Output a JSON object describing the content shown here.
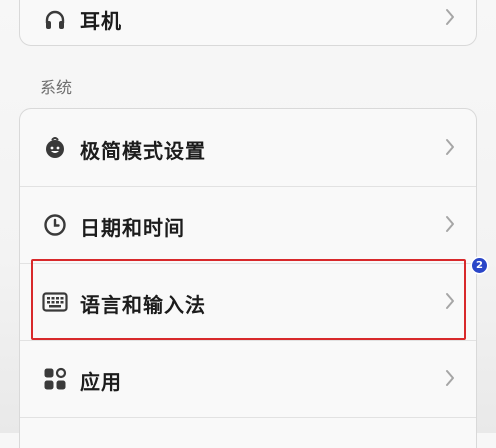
{
  "top_card": {
    "label": "耳机",
    "icon": "headphones-icon"
  },
  "section": {
    "title": "系统"
  },
  "items": [
    {
      "label": "极简模式设置",
      "icon": "simple-mode-icon"
    },
    {
      "label": "日期和时间",
      "icon": "clock-icon"
    },
    {
      "label": "语言和输入法",
      "icon": "keyboard-icon"
    },
    {
      "label": "应用",
      "icon": "apps-icon"
    }
  ],
  "annotation": {
    "badge": "2",
    "highlight_color": "#d8292b",
    "badge_color": "#2a46c8"
  }
}
